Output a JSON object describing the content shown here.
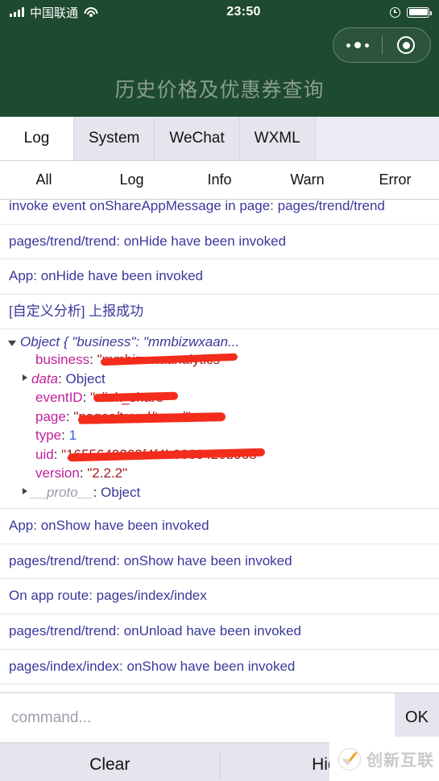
{
  "statusbar": {
    "carrier": "中国联通",
    "time": "23:50",
    "signal_icon": "signal-bars-icon",
    "wifi_icon": "wifi-icon",
    "alarm_icon": "alarm-clock-icon",
    "battery_icon": "battery-full-icon"
  },
  "navbar": {
    "title": "历史价格及优惠券查询",
    "capsule": {
      "menu_icon": "more-dots-icon",
      "close_icon": "target-circle-icon"
    },
    "background_color": "#1e4a2f",
    "title_color": "#8a9e90"
  },
  "panel_tabs": [
    {
      "label": "Log",
      "active": true
    },
    {
      "label": "System",
      "active": false
    },
    {
      "label": "WeChat",
      "active": false
    },
    {
      "label": "WXML",
      "active": false
    }
  ],
  "level_filters": [
    {
      "label": "All"
    },
    {
      "label": "Log"
    },
    {
      "label": "Info"
    },
    {
      "label": "Warn"
    },
    {
      "label": "Error"
    }
  ],
  "log_rows": [
    {
      "text": "invoke event onShareAppMessage in page: pages/trend/trend",
      "clipped": true
    },
    {
      "text": "pages/trend/trend: onHide have been invoked",
      "clipped": false
    },
    {
      "text": "App: onHide have been invoked",
      "clipped": false
    },
    {
      "text": "[自定义分析] 上报成功",
      "clipped": false
    }
  ],
  "object_inspector": {
    "header": "Object { \"business\": \"mmbizwxaan...",
    "properties": [
      {
        "name": "business",
        "value": "\"mmbizwxaanalytics\"",
        "kind": "string",
        "redacted": true,
        "expandable": false
      },
      {
        "name": "data",
        "value": "Object",
        "kind": "object",
        "redacted": false,
        "expandable": true,
        "italic_name": true
      },
      {
        "name": "eventID",
        "value": "\"click_share\"",
        "kind": "string",
        "redacted": true,
        "expandable": false
      },
      {
        "name": "page",
        "value": "\"pages/trend/trend\"",
        "kind": "string",
        "redacted": true,
        "expandable": false
      },
      {
        "name": "type",
        "value": "1",
        "kind": "number",
        "redacted": false,
        "expandable": false
      },
      {
        "name": "uid",
        "value": "\"1655649262f4f4b6666420b968\"",
        "kind": "string",
        "redacted": true,
        "expandable": false
      },
      {
        "name": "version",
        "value": "\"2.2.2\"",
        "kind": "string",
        "redacted": false,
        "expandable": false
      },
      {
        "name": "__proto__",
        "value": "Object",
        "kind": "object",
        "redacted": false,
        "expandable": true,
        "proto": true
      }
    ]
  },
  "log_rows_after": [
    {
      "text": "App: onShow have been invoked"
    },
    {
      "text": "pages/trend/trend: onShow have been invoked"
    },
    {
      "text": "On app route: pages/index/index"
    },
    {
      "text": "pages/trend/trend: onUnload have been invoked"
    },
    {
      "text": "pages/index/index: onShow have been invoked"
    }
  ],
  "command_bar": {
    "placeholder": "command...",
    "value": "",
    "ok_label": "OK"
  },
  "bottom_actions": [
    {
      "label": "Clear"
    },
    {
      "label": "Hide"
    }
  ],
  "watermark": {
    "text": "创新互联",
    "logo_icon": "swoosh-check-logo-icon",
    "accent_color": "#f5a623"
  }
}
